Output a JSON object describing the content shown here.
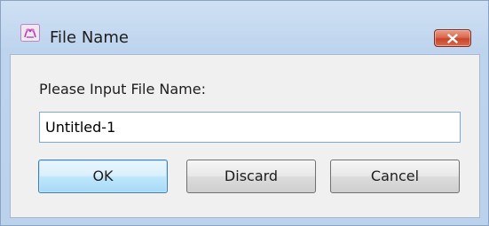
{
  "window": {
    "title": "File Name",
    "icon": "app-icon",
    "close_icon": "close-icon"
  },
  "dialog": {
    "prompt": "Please Input File Name:",
    "filename_value": "Untitled-1"
  },
  "buttons": {
    "ok_label": "OK",
    "discard_label": "Discard",
    "cancel_label": "Cancel"
  },
  "colors": {
    "frame": "#bed4ee",
    "client": "#f0f0f0",
    "close_button": "#d24d32",
    "default_button": "#bee6fd"
  }
}
